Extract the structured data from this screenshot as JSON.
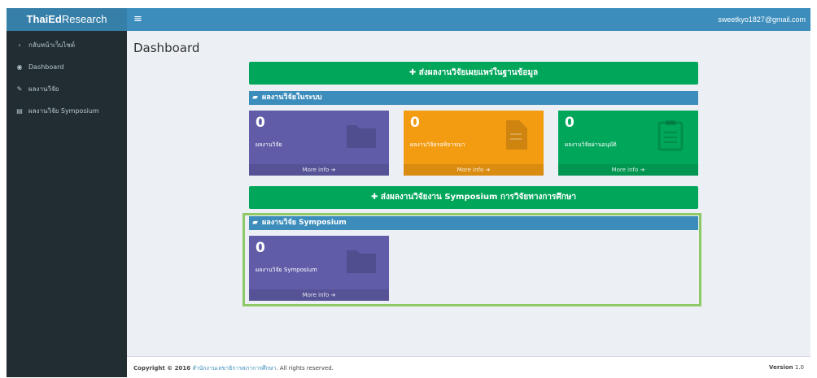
{
  "header": {
    "logo_bold": "ThaiEd",
    "logo_rest": "Research",
    "menu_icon": "hamburger-icon",
    "user_email": "sweetkyo1827@gmail.com"
  },
  "sidebar": {
    "items": [
      {
        "icon": "chevron-left-icon",
        "label": "กลับหน้าเว็บไซต์"
      },
      {
        "icon": "dashboard-icon",
        "label": "Dashboard"
      },
      {
        "icon": "pencil-icon",
        "label": "ผลงานวิจัย"
      },
      {
        "icon": "file-icon",
        "label": "ผลงานวิจัย Symposium"
      }
    ]
  },
  "main": {
    "title": "Dashboard",
    "btn_publish": "ส่งผลงานวิจัยเผยแพร่ในฐานข้อมูล",
    "section1": "ผลงานวิจัยในระบบ",
    "boxes": [
      {
        "value": "0",
        "label": "ผลงานวิจัย",
        "more": "More info",
        "color": "#605ca8",
        "icon": "folder-icon"
      },
      {
        "value": "0",
        "label": "ผลงานวิจัยรอพิจารณา",
        "more": "More info",
        "color": "#f39c12",
        "icon": "document-icon"
      },
      {
        "value": "0",
        "label": "ผลงานวิจัยผ่านอนุมัติ",
        "more": "More info",
        "color": "#00a65a",
        "icon": "clipboard-icon"
      }
    ],
    "btn_symposium": "ส่งผลงานวิจัยงาน Symposium การวิจัยทางการศึกษา",
    "section2": "ผลงานวิจัย Symposium",
    "symposium_box": {
      "value": "0",
      "label": "ผลงานวิจัย Symposium",
      "more": "More info",
      "color": "#605ca8",
      "icon": "folder-icon"
    }
  },
  "footer": {
    "copyright_prefix": "Copyright © 2016",
    "org_link": "สำนักงานเลขาธิการสภาการศึกษา",
    "copyright_suffix": ". All rights reserved.",
    "version_label": "Version",
    "version_value": "1.0"
  }
}
